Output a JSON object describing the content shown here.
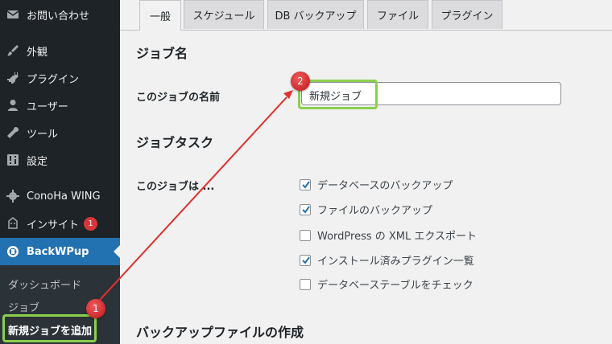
{
  "sidebar": {
    "items": [
      {
        "label": "お問い合わせ",
        "icon": "mail-icon"
      },
      {
        "label": "外観",
        "icon": "paintbrush-icon"
      },
      {
        "label": "プラグイン",
        "icon": "plugin-icon"
      },
      {
        "label": "ユーザー",
        "icon": "user-icon"
      },
      {
        "label": "ツール",
        "icon": "wrench-icon"
      },
      {
        "label": "設定",
        "icon": "settings-icon"
      },
      {
        "label": "ConoHa WING",
        "icon": "gear-icon"
      },
      {
        "label": "インサイト",
        "icon": "monsterinsights-icon",
        "badge": "1"
      },
      {
        "label": "BackWPup",
        "icon": "backwpup-icon"
      }
    ],
    "submenu": [
      "ダッシュボード",
      "ジョブ",
      "新規ジョブを追加"
    ]
  },
  "tabs": [
    "一般",
    "スケジュール",
    "DB バックアップ",
    "ファイル",
    "プラグイン"
  ],
  "main": {
    "job_name_section": "ジョブ名",
    "job_name_label": "このジョブの名前",
    "job_name_value": "新規ジョブ",
    "job_tasks_section": "ジョブタスク",
    "job_tasks_label": "このジョブは ...",
    "tasks": [
      {
        "label": "データベースのバックアップ",
        "checked": true
      },
      {
        "label": "ファイルのバックアップ",
        "checked": true
      },
      {
        "label": "WordPress の XML エクスポート",
        "checked": false
      },
      {
        "label": "インストール済みプラグイン一覧",
        "checked": true
      },
      {
        "label": "データベーステーブルをチェック",
        "checked": false
      }
    ],
    "archive_section": "バックアップファイルの作成"
  },
  "annotations": {
    "marker1": "1",
    "marker2": "2"
  },
  "colors": {
    "sidebar": "#1d2327",
    "active": "#2271b1",
    "highlight": "#8ccf4d",
    "marker": "#d21f26",
    "arrow": "#e03030"
  }
}
